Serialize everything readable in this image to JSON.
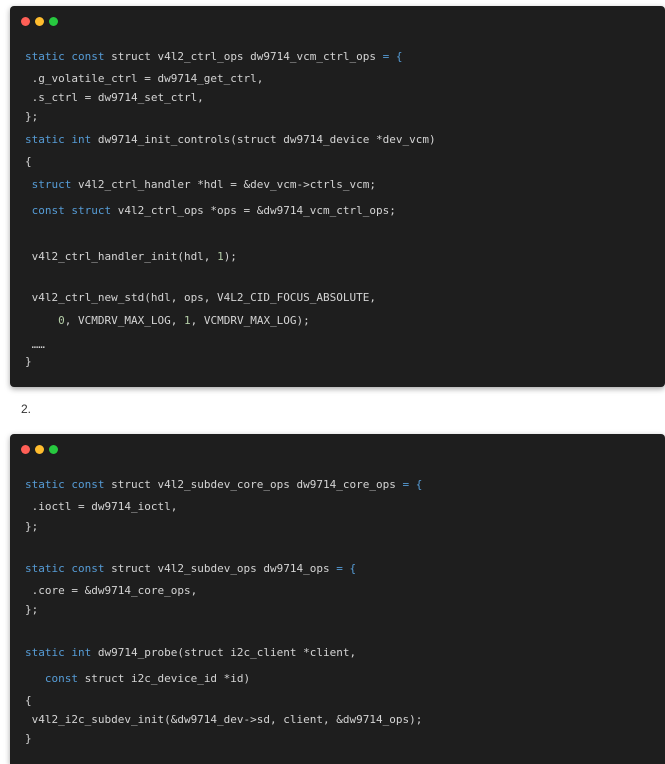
{
  "block1": {
    "lines": [
      {
        "segs": [
          {
            "t": "static const",
            "c": "kw"
          },
          {
            "t": " struct v4l2_ctrl_ops dw9714_vcm_ctrl_ops ",
            "c": ""
          },
          {
            "t": "= {",
            "c": "kw"
          }
        ]
      },
      {
        "segs": [
          {
            "t": " .g_volatile_ctrl = dw9714_get_ctrl,",
            "c": ""
          }
        ]
      },
      {
        "segs": [
          {
            "t": " .s_ctrl = dw9714_set_ctrl,",
            "c": ""
          }
        ]
      },
      {
        "segs": [
          {
            "t": "};",
            "c": ""
          }
        ]
      },
      {
        "segs": [
          {
            "t": "static int",
            "c": "kw"
          },
          {
            "t": " dw9714_init_controls(struct dw9714_device *dev_vcm)",
            "c": ""
          }
        ]
      },
      {
        "segs": [
          {
            "t": "{",
            "c": ""
          }
        ]
      },
      {
        "segs": [
          {
            "t": " struct",
            "c": "kw"
          },
          {
            "t": " v4l2_ctrl_handler *hdl = &dev_vcm->ctrls_vcm;",
            "c": ""
          }
        ]
      },
      {
        "segs": [
          {
            "t": " const struct",
            "c": "kw"
          },
          {
            "t": " v4l2_ctrl_ops *ops = &dw9714_vcm_ctrl_ops;",
            "c": ""
          }
        ]
      },
      {
        "segs": [
          {
            "t": " v4l2_ctrl_handler_init(hdl, ",
            "c": ""
          },
          {
            "t": "1",
            "c": "num"
          },
          {
            "t": ");",
            "c": ""
          }
        ]
      },
      {
        "segs": [
          {
            "t": " v4l2_ctrl_new_std(hdl, ops, V4L2_CID_FOCUS_ABSOLUTE,",
            "c": ""
          }
        ]
      },
      {
        "segs": [
          {
            "t": "     ",
            "c": ""
          },
          {
            "t": "0",
            "c": "num"
          },
          {
            "t": ", VCMDRV_MAX_LOG, ",
            "c": ""
          },
          {
            "t": "1",
            "c": "num"
          },
          {
            "t": ", VCMDRV_MAX_LOG);",
            "c": ""
          }
        ]
      },
      {
        "segs": [
          {
            "t": " ……",
            "c": ""
          }
        ]
      },
      {
        "segs": [
          {
            "t": "}",
            "c": ""
          }
        ]
      }
    ]
  },
  "separator_label": "2.",
  "block2": {
    "lines": [
      {
        "segs": [
          {
            "t": "static const",
            "c": "kw"
          },
          {
            "t": " struct v4l2_subdev_core_ops dw9714_core_ops ",
            "c": ""
          },
          {
            "t": "= {",
            "c": "kw"
          }
        ]
      },
      {
        "segs": [
          {
            "t": " .ioctl = dw9714_ioctl,",
            "c": ""
          }
        ]
      },
      {
        "segs": [
          {
            "t": "};",
            "c": ""
          }
        ]
      },
      {
        "segs": [
          {
            "t": "static const",
            "c": "kw"
          },
          {
            "t": " struct v4l2_subdev_ops dw9714_ops ",
            "c": ""
          },
          {
            "t": "= {",
            "c": "kw"
          }
        ]
      },
      {
        "segs": [
          {
            "t": " .core = &dw9714_core_ops,",
            "c": ""
          }
        ]
      },
      {
        "segs": [
          {
            "t": "};",
            "c": ""
          }
        ]
      },
      {
        "segs": [
          {
            "t": "static int",
            "c": "kw"
          },
          {
            "t": " dw9714_probe(struct i2c_client *client,",
            "c": ""
          }
        ]
      },
      {
        "segs": [
          {
            "t": "   const",
            "c": "kw"
          },
          {
            "t": " struct i2c_device_id *id)",
            "c": ""
          }
        ]
      },
      {
        "segs": [
          {
            "t": "{",
            "c": ""
          }
        ]
      },
      {
        "segs": [
          {
            "t": " v4l2_i2c_subdev_init(&dw9714_dev->sd, client, &dw9714_ops);",
            "c": ""
          }
        ]
      },
      {
        "segs": [
          {
            "t": "}",
            "c": ""
          }
        ]
      }
    ]
  }
}
